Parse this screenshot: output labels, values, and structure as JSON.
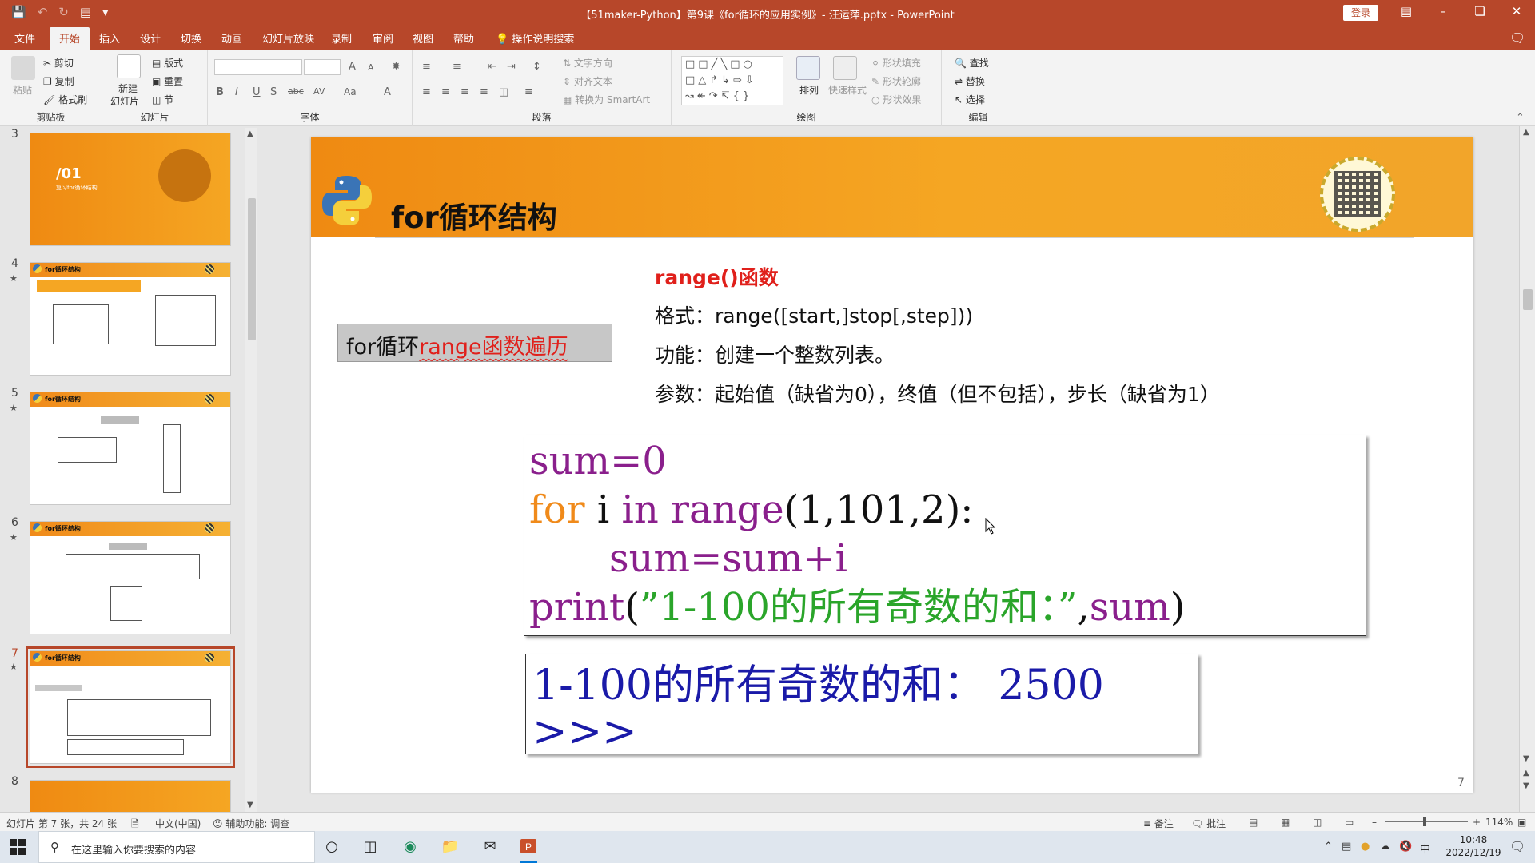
{
  "window": {
    "title": "【51maker-Python】第9课《for循环的应用实例》- 汪运萍.pptx  -  PowerPoint",
    "login": "登录"
  },
  "tabs": [
    "文件",
    "开始",
    "插入",
    "设计",
    "切换",
    "动画",
    "幻灯片放映",
    "录制",
    "审阅",
    "视图",
    "帮助",
    "操作说明搜索"
  ],
  "ribbon": {
    "clipboard": {
      "label": "剪贴板",
      "paste": "粘贴",
      "cut": "剪切",
      "copy": "复制",
      "format_painter": "格式刷"
    },
    "slides": {
      "label": "幻灯片",
      "new_slide": "新建",
      "new_slide2": "幻灯片",
      "layout": "版式",
      "reset": "重置",
      "section": "节"
    },
    "font": {
      "label": "字体"
    },
    "paragraph": {
      "label": "段落",
      "text_direction": "文字方向",
      "align_text": "对齐文本",
      "smartart": "转换为 SmartArt"
    },
    "drawing": {
      "label": "绘图",
      "arrange": "排列",
      "quick_styles": "快速样式",
      "shape_fill": "形状填充",
      "shape_outline": "形状轮廓",
      "shape_effects": "形状效果"
    },
    "editing": {
      "label": "编辑",
      "find": "查找",
      "replace": "替换",
      "select": "选择"
    }
  },
  "thumbnails": [
    {
      "num": "3",
      "star": false,
      "title": "/01",
      "subtitle": "复习for循环结构"
    },
    {
      "num": "4",
      "star": true,
      "title": "for循环结构"
    },
    {
      "num": "5",
      "star": true,
      "title": "for循环结构"
    },
    {
      "num": "6",
      "star": true,
      "title": "for循环结构"
    },
    {
      "num": "7",
      "star": true,
      "title": "for循环结构"
    },
    {
      "num": "8",
      "star": false,
      "title": ""
    }
  ],
  "slide": {
    "title": "for循环结构",
    "label_black": "for循环",
    "label_red": "range函数遍历",
    "desc_head": "range()函数",
    "desc_format": "格式：range([start,]stop[,step]))",
    "desc_function": "功能：创建一个整数列表。",
    "desc_params": "参数：起始值（缺省为0），终值（但不包括），步长（缺省为1）",
    "code": {
      "l1": "sum=0",
      "l2_kw1": "for",
      "l2_var": "i",
      "l2_kw2": "in",
      "l2_kw3": "range",
      "l2_args": "(1,101,2):",
      "l3": "sum=sum+i",
      "l4_fn": "print",
      "l4_paren": "(",
      "l4_str": "”1-100的所有奇数的和：”",
      "l4_comma": ",",
      "l4_sum": "sum",
      "l4_close": ")"
    },
    "output": {
      "line1": "1-100的所有奇数的和：  2500",
      "line2": ">>>"
    },
    "page_number": "7"
  },
  "statusbar": {
    "slide_info": "幻灯片 第 7 张，共 24 张",
    "language": "中文(中国)",
    "accessibility": "辅助功能: 调查",
    "notes": "备注",
    "comments": "批注",
    "zoom": "114%"
  },
  "taskbar": {
    "search_placeholder": "在这里输入你要搜索的内容",
    "time": "10:48",
    "date": "2022/12/19",
    "ime": "中"
  }
}
